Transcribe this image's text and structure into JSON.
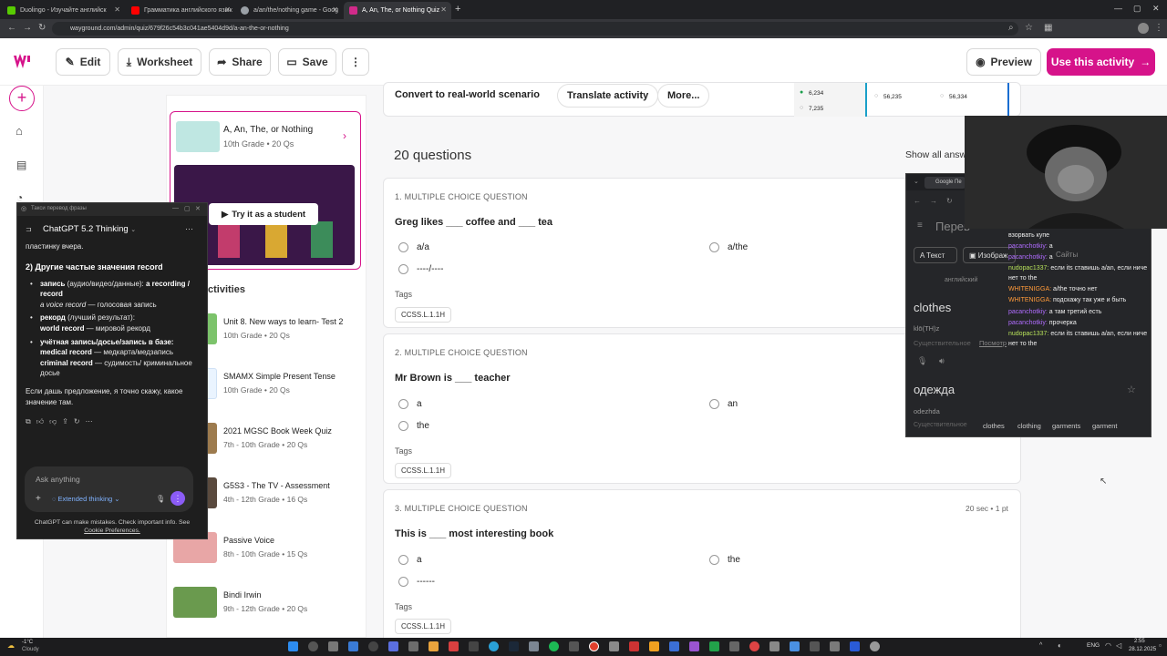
{
  "browser": {
    "tabs": [
      {
        "label": "Duolingo - Изучайте английск",
        "color": "#58cc02"
      },
      {
        "label": "Грамматика английского язык",
        "color": "#ff0000"
      },
      {
        "label": "a/an/the/nothing game - Goog",
        "color": "#9aa0a6"
      },
      {
        "label": "A, An, The, or Nothing Quiz",
        "color": "#d12a8a"
      }
    ],
    "url": "wayground.com/admin/quiz/679f26c54b3c041ae5404d9d/a-an-the-or-nothing"
  },
  "header": {
    "edit": "Edit",
    "worksheet": "Worksheet",
    "share": "Share",
    "save": "Save",
    "preview": "Preview",
    "use": "Use this activity",
    "brand_color": "#d6138a"
  },
  "toolbar": {
    "convert": "Convert to real-world scenario",
    "translate": "Translate activity",
    "more": "More...",
    "stats": [
      "6,234",
      "7,235",
      "56,235",
      "56,334"
    ]
  },
  "quiz_card": {
    "title": "A, An, The, or Nothing",
    "sub": "10th Grade • 20 Qs",
    "try": "Try it as a student"
  },
  "activities": {
    "heading": "ctivities",
    "items": [
      {
        "title": "Unit 8. New ways to learn- Test 2",
        "sub": "10th Grade • 20 Qs"
      },
      {
        "title": "SMAMX Simple Present Tense",
        "sub": "10th Grade • 20 Qs"
      },
      {
        "title": "2021 MGSC Book Week Quiz",
        "sub": "7th - 10th Grade • 20 Qs"
      },
      {
        "title": "G5S3 - The TV - Assessment",
        "sub": "4th - 12th Grade • 16 Qs"
      },
      {
        "title": "Passive Voice",
        "sub": "8th - 10th Grade • 15 Qs"
      },
      {
        "title": "Bindi Irwin",
        "sub": "9th - 12th Grade • 20 Qs"
      }
    ]
  },
  "questions": {
    "count": "20 questions",
    "show_all": "Show all answ",
    "tags_label": "Tags",
    "list": [
      {
        "num": "1.  MULTIPLE CHOICE QUESTION",
        "text": "Greg likes ___ coffee and ___ tea",
        "a": "a/a",
        "b": "a/the",
        "c": "----/----",
        "tag": "CCSS.L.1.1H"
      },
      {
        "num": "2.  MULTIPLE CHOICE QUESTION",
        "text": "Mr Brown is ___ teacher",
        "a": "a",
        "b": "an",
        "c": "the",
        "tag": "CCSS.L.1.1H"
      },
      {
        "num": "3.  MULTIPLE CHOICE QUESTION",
        "text": "This is ___ most interesting book",
        "a": "a",
        "b": "the",
        "c": "------",
        "tag": "CCSS.L.1.1H",
        "meta": "20 sec • 1 pt"
      }
    ]
  },
  "gpt": {
    "window_title": "Такси перевод фразы",
    "model": "ChatGPT 5.2 Thinking",
    "line0": "пластинку вчера.",
    "heading": "2) Другие частые значения record",
    "b1a": "запись",
    "b1b": " (аудио/видео/данные): ",
    "b1c": "a recording / record",
    "b1d": "a voice record",
    "b1e": " — голосовая запись",
    "b2a": "рекорд",
    "b2b": " (лучший результат):",
    "b2c": "world record",
    "b2d": " — мировой рекорд",
    "b3a": "учётная запись/досье/запись в базе:",
    "b3b": "medical record",
    "b3c": " — медкарта/медзапись",
    "b3d": "criminal record",
    "b3e": " — судимость/ криминальное досье",
    "outro": "Если дашь предложение, я точно скажу, какое значение там.",
    "ask": "Ask anything",
    "ext": "Extended thinking",
    "footer1": "ChatGPT can make mistakes. Check important info. See",
    "footer2": "Cookie Preferences."
  },
  "translator": {
    "title": "Google Пе",
    "header": "Перев",
    "tab_text": "Текст",
    "tab_img": "Изображ",
    "tab_sites": "Сайты",
    "lang": "английский",
    "word": "clothes",
    "phon": "klō(TH)z",
    "pos": "Существительное",
    "see": "Посмотр",
    "trans": "одежда",
    "translit": "odezhda",
    "pos2": "Существительное",
    "chips": [
      "clothes",
      "clothing",
      "garments",
      "garment"
    ]
  },
  "stream_chat": [
    {
      "user": "",
      "msg": "взорвать купе",
      "color": "#fff"
    },
    {
      "user": "pacanchotkiy:",
      "msg": " a",
      "color": "#b06cff"
    },
    {
      "user": "pacanchotkiy:",
      "msg": " a",
      "color": "#b06cff"
    },
    {
      "user": "nudopac1337:",
      "msg": " если its ставишь a/an, если ниче",
      "color": "#b6e05a"
    },
    {
      "user": "",
      "msg": "нет то the",
      "color": "#fff"
    },
    {
      "user": "WHITENIGGA:",
      "msg": " a/the точно нет",
      "color": "#ff9a3a"
    },
    {
      "user": "WHITENIGGA:",
      "msg": " подскажу так уже и быть",
      "color": "#ff9a3a"
    },
    {
      "user": "pacanchotkiy:",
      "msg": " а там третий есть",
      "color": "#b06cff"
    },
    {
      "user": "pacanchotkiy:",
      "msg": " прочерка",
      "color": "#b06cff"
    },
    {
      "user": "nudopac1337:",
      "msg": " если its ставишь a/an, если ниче",
      "color": "#b6e05a"
    },
    {
      "user": "",
      "msg": "нет то the",
      "color": "#fff"
    }
  ],
  "taskbar": {
    "weather_temp": "-1°C",
    "weather_desc": "Cloudy",
    "lang": "ENG",
    "time": "2:55",
    "date": "28.12.2025"
  }
}
